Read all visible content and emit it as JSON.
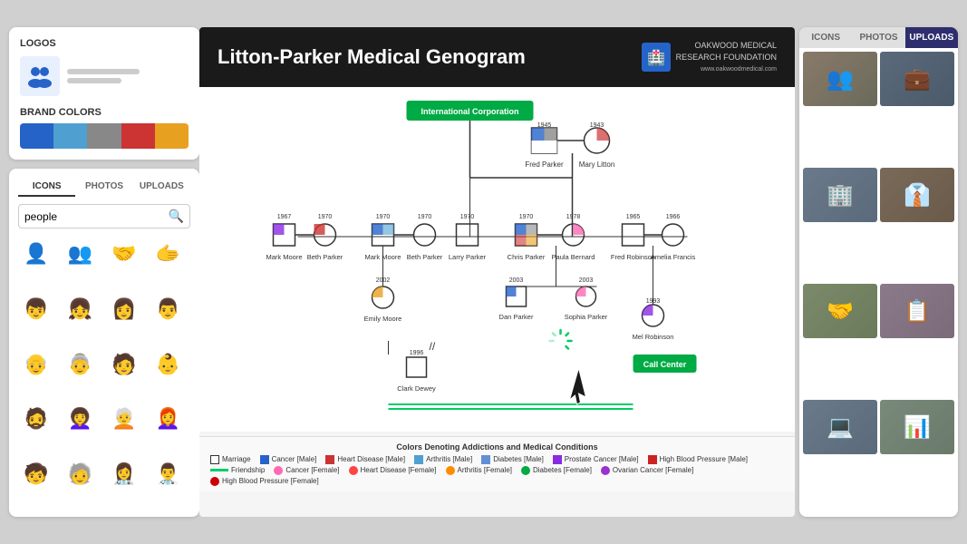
{
  "leftPanel": {
    "logos": {
      "title": "LOGOS",
      "iconEmoji": "👥",
      "lines": [
        {
          "width": 80
        },
        {
          "width": 60
        }
      ]
    },
    "brandColors": {
      "title": "BRAND COLORS",
      "swatches": [
        "#2563c9",
        "#4fa0d0",
        "#888",
        "#cc3333",
        "#e8a020"
      ]
    },
    "tabs": [
      "ICONS",
      "PHOTOS",
      "UPLOADS"
    ],
    "activeTab": "ICONS",
    "search": {
      "placeholder": "people",
      "value": "people"
    },
    "icons": [
      "👤",
      "👥",
      "🤝",
      "🫱",
      "👦",
      "👧",
      "👩",
      "👨",
      "👴",
      "👵",
      "🧑",
      "👶",
      "🧔",
      "👩‍🦱",
      "🧑‍🦳",
      "👩‍🦰",
      "👦",
      "👧",
      "🧒",
      "🧓"
    ]
  },
  "genogram": {
    "title": "Litton-Parker Medical Genogram",
    "org": {
      "name": "OAKWOOD MEDICAL\nRESEARCH FOUNDATION",
      "website": "www.oakwoodmedical.com"
    },
    "people": [
      {
        "id": "fred_parker",
        "name": "Fred Parker",
        "year": "1945",
        "gender": "male"
      },
      {
        "id": "mary_litton",
        "name": "Mary Litton",
        "year": "1943",
        "gender": "female"
      },
      {
        "id": "mark_moore",
        "name": "Mark Moore",
        "year": "1967",
        "gender": "male"
      },
      {
        "id": "beth_parker",
        "name": "Beth Parker",
        "year": "1970",
        "gender": "female"
      },
      {
        "id": "mark_moore2",
        "name": "Mark Moore",
        "year": "1970",
        "gender": "male"
      },
      {
        "id": "beth_parker2",
        "name": "Beth Parker",
        "year": "1970",
        "gender": "female"
      },
      {
        "id": "larry_parker",
        "name": "Larry Parker",
        "year": "1970",
        "gender": "male"
      },
      {
        "id": "chris_parker",
        "name": "Chris Parker",
        "year": "1970",
        "gender": "male"
      },
      {
        "id": "paula_bernard",
        "name": "Paula Bernard",
        "year": "1978",
        "gender": "female"
      },
      {
        "id": "fred_robinson",
        "name": "Fred Robinson",
        "year": "1965",
        "gender": "male"
      },
      {
        "id": "amelia_francis",
        "name": "Amelia Francis",
        "year": "1966",
        "gender": "female"
      },
      {
        "id": "emily_moore",
        "name": "Emily Moore",
        "year": "2002",
        "gender": "female"
      },
      {
        "id": "dan_parker",
        "name": "Dan Parker",
        "year": "2003",
        "gender": "male"
      },
      {
        "id": "sophia_parker",
        "name": "Sophia Parker",
        "year": "2003",
        "gender": "female"
      },
      {
        "id": "mel_robinson",
        "name": "Mel Robinson",
        "year": "1993",
        "gender": "female"
      },
      {
        "id": "clark_dewey",
        "name": "Clark Dewey",
        "year": "1996",
        "gender": "male"
      },
      {
        "id": "call_center",
        "name": "Call Center",
        "type": "org"
      }
    ],
    "corporation": "International Corporation"
  },
  "rightPanel": {
    "tabs": [
      "ICONS",
      "PHOTOS",
      "UPLOADS"
    ],
    "activeTab": "UPLOADS",
    "photos": [
      {
        "id": 1,
        "bg": "#8a7a6a",
        "emoji": "👥"
      },
      {
        "id": 2,
        "bg": "#6a7a8a",
        "emoji": "💼"
      },
      {
        "id": 3,
        "bg": "#7a8a6a",
        "emoji": "🏢"
      },
      {
        "id": 4,
        "bg": "#8a6a7a",
        "emoji": "👔"
      },
      {
        "id": 5,
        "bg": "#7a7a8a",
        "emoji": "🤝"
      },
      {
        "id": 6,
        "bg": "#8a8a6a",
        "emoji": "📋"
      },
      {
        "id": 7,
        "bg": "#6a8a7a",
        "emoji": "💻"
      },
      {
        "id": 8,
        "bg": "#7a6a8a",
        "emoji": "📊"
      }
    ]
  },
  "legend": {
    "title": "Colors Denoting Addictions and Medical Conditions",
    "items": [
      {
        "type": "line",
        "color": "#333",
        "label": "Marriage"
      },
      {
        "type": "dot",
        "color": "#2563c9",
        "label": "Cancer [Male]"
      },
      {
        "type": "dot",
        "color": "#cc3333",
        "label": "Heart Disease [Male]"
      },
      {
        "type": "dot",
        "color": "#4fa0d0",
        "label": "Arthritis [Male]"
      },
      {
        "type": "dot",
        "color": "#2563c9",
        "label": "Diabetes [Male]"
      },
      {
        "type": "dot",
        "color": "#8a2be2",
        "label": "Prostate Cancer [Male]"
      },
      {
        "type": "dot",
        "color": "#cc2222",
        "label": "High Blood Pressure  [Male]"
      },
      {
        "type": "line",
        "color": "#00cc66",
        "label": "Friendship"
      },
      {
        "type": "dot",
        "color": "#ff69b4",
        "label": "Cancer [Female]"
      },
      {
        "type": "dot",
        "color": "#ff4444",
        "label": "Heart Disease [Female]"
      },
      {
        "type": "dot",
        "color": "#ff8c00",
        "label": "Arthritis [Female]"
      },
      {
        "type": "dot",
        "color": "#00aa44",
        "label": "Diabetes [Female]"
      },
      {
        "type": "dot",
        "color": "#9932cc",
        "label": "Ovarian Cancer [Female]"
      },
      {
        "type": "dot",
        "color": "#cc0000",
        "label": "High Blood Pressure [Female]"
      }
    ]
  }
}
